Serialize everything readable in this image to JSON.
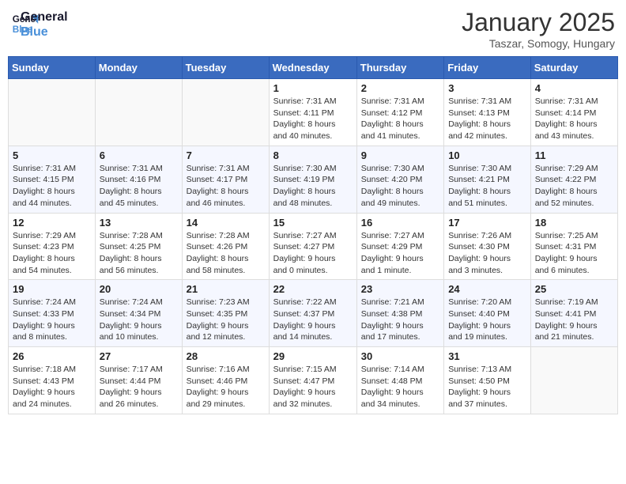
{
  "logo": {
    "line1": "General",
    "line2": "Blue"
  },
  "title": "January 2025",
  "location": "Taszar, Somogy, Hungary",
  "weekdays": [
    "Sunday",
    "Monday",
    "Tuesday",
    "Wednesday",
    "Thursday",
    "Friday",
    "Saturday"
  ],
  "weeks": [
    [
      {
        "day": "",
        "info": ""
      },
      {
        "day": "",
        "info": ""
      },
      {
        "day": "",
        "info": ""
      },
      {
        "day": "1",
        "info": "Sunrise: 7:31 AM\nSunset: 4:11 PM\nDaylight: 8 hours\nand 40 minutes."
      },
      {
        "day": "2",
        "info": "Sunrise: 7:31 AM\nSunset: 4:12 PM\nDaylight: 8 hours\nand 41 minutes."
      },
      {
        "day": "3",
        "info": "Sunrise: 7:31 AM\nSunset: 4:13 PM\nDaylight: 8 hours\nand 42 minutes."
      },
      {
        "day": "4",
        "info": "Sunrise: 7:31 AM\nSunset: 4:14 PM\nDaylight: 8 hours\nand 43 minutes."
      }
    ],
    [
      {
        "day": "5",
        "info": "Sunrise: 7:31 AM\nSunset: 4:15 PM\nDaylight: 8 hours\nand 44 minutes."
      },
      {
        "day": "6",
        "info": "Sunrise: 7:31 AM\nSunset: 4:16 PM\nDaylight: 8 hours\nand 45 minutes."
      },
      {
        "day": "7",
        "info": "Sunrise: 7:31 AM\nSunset: 4:17 PM\nDaylight: 8 hours\nand 46 minutes."
      },
      {
        "day": "8",
        "info": "Sunrise: 7:30 AM\nSunset: 4:19 PM\nDaylight: 8 hours\nand 48 minutes."
      },
      {
        "day": "9",
        "info": "Sunrise: 7:30 AM\nSunset: 4:20 PM\nDaylight: 8 hours\nand 49 minutes."
      },
      {
        "day": "10",
        "info": "Sunrise: 7:30 AM\nSunset: 4:21 PM\nDaylight: 8 hours\nand 51 minutes."
      },
      {
        "day": "11",
        "info": "Sunrise: 7:29 AM\nSunset: 4:22 PM\nDaylight: 8 hours\nand 52 minutes."
      }
    ],
    [
      {
        "day": "12",
        "info": "Sunrise: 7:29 AM\nSunset: 4:23 PM\nDaylight: 8 hours\nand 54 minutes."
      },
      {
        "day": "13",
        "info": "Sunrise: 7:28 AM\nSunset: 4:25 PM\nDaylight: 8 hours\nand 56 minutes."
      },
      {
        "day": "14",
        "info": "Sunrise: 7:28 AM\nSunset: 4:26 PM\nDaylight: 8 hours\nand 58 minutes."
      },
      {
        "day": "15",
        "info": "Sunrise: 7:27 AM\nSunset: 4:27 PM\nDaylight: 9 hours\nand 0 minutes."
      },
      {
        "day": "16",
        "info": "Sunrise: 7:27 AM\nSunset: 4:29 PM\nDaylight: 9 hours\nand 1 minute."
      },
      {
        "day": "17",
        "info": "Sunrise: 7:26 AM\nSunset: 4:30 PM\nDaylight: 9 hours\nand 3 minutes."
      },
      {
        "day": "18",
        "info": "Sunrise: 7:25 AM\nSunset: 4:31 PM\nDaylight: 9 hours\nand 6 minutes."
      }
    ],
    [
      {
        "day": "19",
        "info": "Sunrise: 7:24 AM\nSunset: 4:33 PM\nDaylight: 9 hours\nand 8 minutes."
      },
      {
        "day": "20",
        "info": "Sunrise: 7:24 AM\nSunset: 4:34 PM\nDaylight: 9 hours\nand 10 minutes."
      },
      {
        "day": "21",
        "info": "Sunrise: 7:23 AM\nSunset: 4:35 PM\nDaylight: 9 hours\nand 12 minutes."
      },
      {
        "day": "22",
        "info": "Sunrise: 7:22 AM\nSunset: 4:37 PM\nDaylight: 9 hours\nand 14 minutes."
      },
      {
        "day": "23",
        "info": "Sunrise: 7:21 AM\nSunset: 4:38 PM\nDaylight: 9 hours\nand 17 minutes."
      },
      {
        "day": "24",
        "info": "Sunrise: 7:20 AM\nSunset: 4:40 PM\nDaylight: 9 hours\nand 19 minutes."
      },
      {
        "day": "25",
        "info": "Sunrise: 7:19 AM\nSunset: 4:41 PM\nDaylight: 9 hours\nand 21 minutes."
      }
    ],
    [
      {
        "day": "26",
        "info": "Sunrise: 7:18 AM\nSunset: 4:43 PM\nDaylight: 9 hours\nand 24 minutes."
      },
      {
        "day": "27",
        "info": "Sunrise: 7:17 AM\nSunset: 4:44 PM\nDaylight: 9 hours\nand 26 minutes."
      },
      {
        "day": "28",
        "info": "Sunrise: 7:16 AM\nSunset: 4:46 PM\nDaylight: 9 hours\nand 29 minutes."
      },
      {
        "day": "29",
        "info": "Sunrise: 7:15 AM\nSunset: 4:47 PM\nDaylight: 9 hours\nand 32 minutes."
      },
      {
        "day": "30",
        "info": "Sunrise: 7:14 AM\nSunset: 4:48 PM\nDaylight: 9 hours\nand 34 minutes."
      },
      {
        "day": "31",
        "info": "Sunrise: 7:13 AM\nSunset: 4:50 PM\nDaylight: 9 hours\nand 37 minutes."
      },
      {
        "day": "",
        "info": ""
      }
    ]
  ]
}
